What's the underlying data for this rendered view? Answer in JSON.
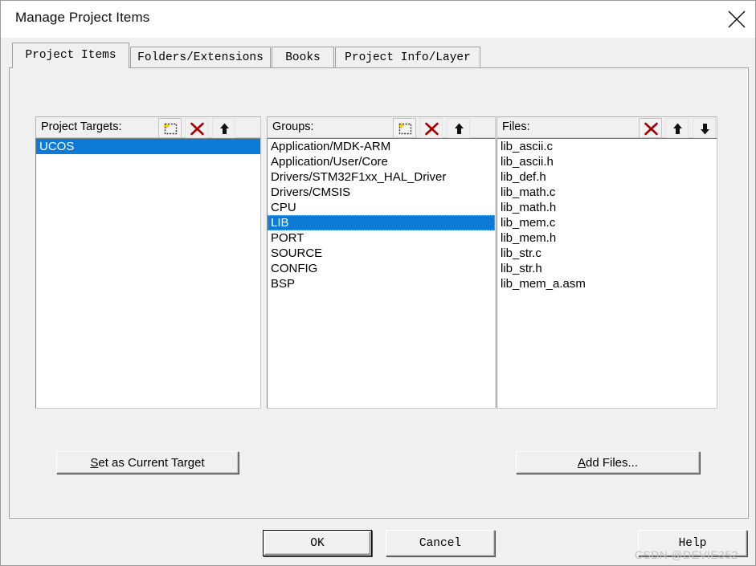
{
  "window": {
    "title": "Manage Project Items",
    "close_icon": "close-icon"
  },
  "tabs": [
    {
      "label": "Project Items",
      "active": true
    },
    {
      "label": "Folders/Extensions",
      "active": false
    },
    {
      "label": "Books",
      "active": false
    },
    {
      "label": "Project Info/Layer",
      "active": false
    }
  ],
  "panels": {
    "targets": {
      "label": "Project Targets:",
      "tools": [
        "new-item-icon",
        "delete-icon",
        "move-up-icon",
        "move-down-icon"
      ],
      "items": [
        "UCOS"
      ],
      "selected_index": 0
    },
    "groups": {
      "label": "Groups:",
      "tools": [
        "new-item-icon",
        "delete-icon",
        "move-up-icon",
        "move-down-icon"
      ],
      "items": [
        "Application/MDK-ARM",
        "Application/User/Core",
        "Drivers/STM32F1xx_HAL_Driver",
        "Drivers/CMSIS",
        "CPU",
        "LIB",
        "PORT",
        "SOURCE",
        "CONFIG",
        "BSP"
      ],
      "selected_index": 5
    },
    "files": {
      "label": "Files:",
      "tools": [
        "delete-icon",
        "move-up-icon",
        "move-down-icon"
      ],
      "items": [
        "lib_ascii.c",
        "lib_ascii.h",
        "lib_def.h",
        "lib_math.c",
        "lib_math.h",
        "lib_mem.c",
        "lib_mem.h",
        "lib_str.c",
        "lib_str.h",
        "lib_mem_a.asm"
      ],
      "selected_index": -1
    }
  },
  "buttons": {
    "set_current_target": {
      "accel": "S",
      "rest": "et as Current Target"
    },
    "add_files": {
      "accel": "A",
      "rest": "dd Files..."
    },
    "ok": "OK",
    "cancel": "Cancel",
    "help": "Help"
  },
  "watermark": "CSDN @DEVIE352",
  "colors": {
    "selection": "#0d7bd6",
    "dialog_face": "#f0f0f0",
    "delete_icon": "#a80000",
    "accent_yellow": "#ffd200"
  }
}
